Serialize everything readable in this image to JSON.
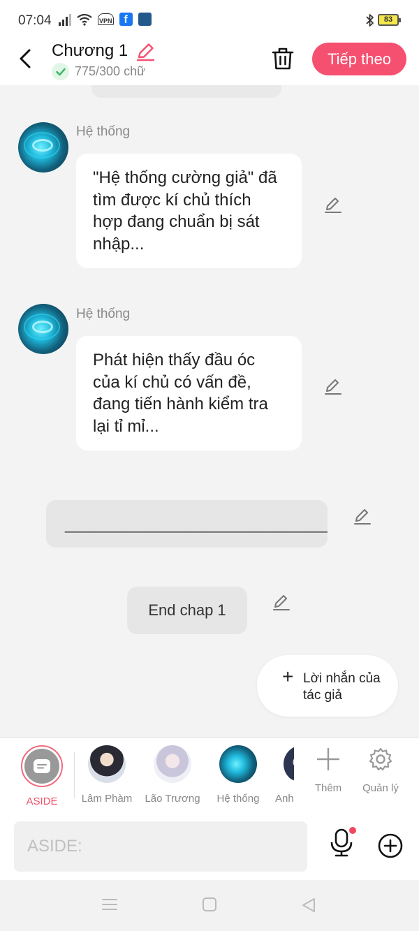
{
  "status_bar": {
    "time": "07:04",
    "vpn_label": "VPN",
    "facebook_icon": "f",
    "battery": "83",
    "icons": [
      "signal-icon",
      "wifi-icon",
      "vpn-icon",
      "facebook-icon",
      "app-icon",
      "bluetooth-icon",
      "battery-icon"
    ]
  },
  "header": {
    "title": "Chương 1",
    "word_count": "775/300 chữ",
    "next_label": "Tiếp theo"
  },
  "messages": [
    {
      "sender": "Hệ thống",
      "text": "\"Hệ thống cường giả\" đã tìm được kí chủ thích hợp đang chuẩn bị sát nhập..."
    },
    {
      "sender": "Hệ thống",
      "text": "Phát hiện thấy đầu óc của kí chủ có vấn đề, đang tiến hành kiểm tra lại tỉ mỉ..."
    }
  ],
  "aside_message": "________________________________",
  "end_message": "End chap 1",
  "author_note": {
    "plus": "+",
    "label": "Lời nhắn của tác giả"
  },
  "characters": [
    {
      "name": "ASIDE",
      "selected": true
    },
    {
      "name": "Lâm Phàm"
    },
    {
      "name": "Lão Trương"
    },
    {
      "name": "Hệ thống"
    },
    {
      "name": "Anh"
    }
  ],
  "tools": {
    "more_label": "Thêm",
    "manage_label": "Quản lý"
  },
  "input": {
    "placeholder": "ASIDE:"
  },
  "colors": {
    "accent": "#f65070",
    "background": "#f3f3f3"
  }
}
